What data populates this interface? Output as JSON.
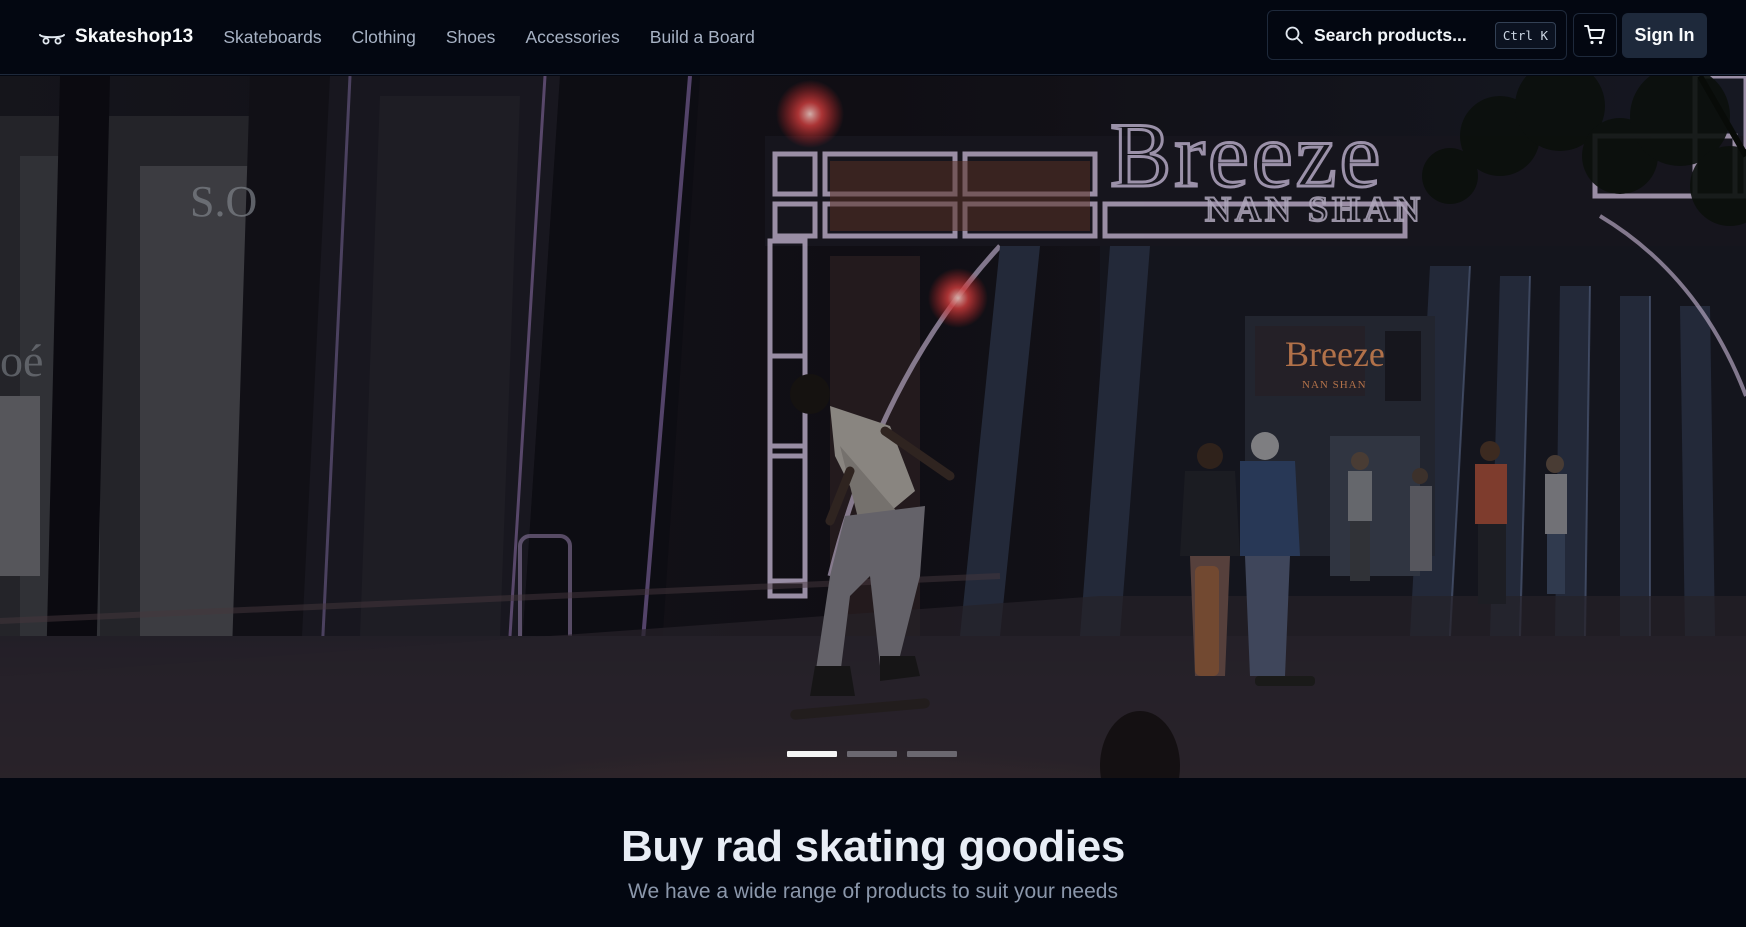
{
  "header": {
    "brand": "Skateshop13",
    "brand_icon": "skateboard-icon",
    "nav": [
      "Skateboards",
      "Clothing",
      "Shoes",
      "Accessories",
      "Build a Board"
    ],
    "search": {
      "placeholder": "Search products...",
      "shortcut": "Ctrl K",
      "icon": "search-icon"
    },
    "cart_icon": "cart-icon",
    "sign_in": "Sign In"
  },
  "hero": {
    "image": "night-street-skateboarder-photo",
    "signage": {
      "main": "Breeze",
      "sub": "NAN SHAN",
      "store_sign": "Breeze",
      "store_sub": "NAN SHAN"
    },
    "carousel": {
      "slides": 3,
      "active": 0
    }
  },
  "intro": {
    "title": "Buy rad skating goodies",
    "subtitle": "We have a wide range of products to suit your needs"
  },
  "colors": {
    "background": "#030711",
    "border": "#1e293b",
    "nav_text": "#a7b2c4",
    "button_bg": "#1e293b"
  }
}
